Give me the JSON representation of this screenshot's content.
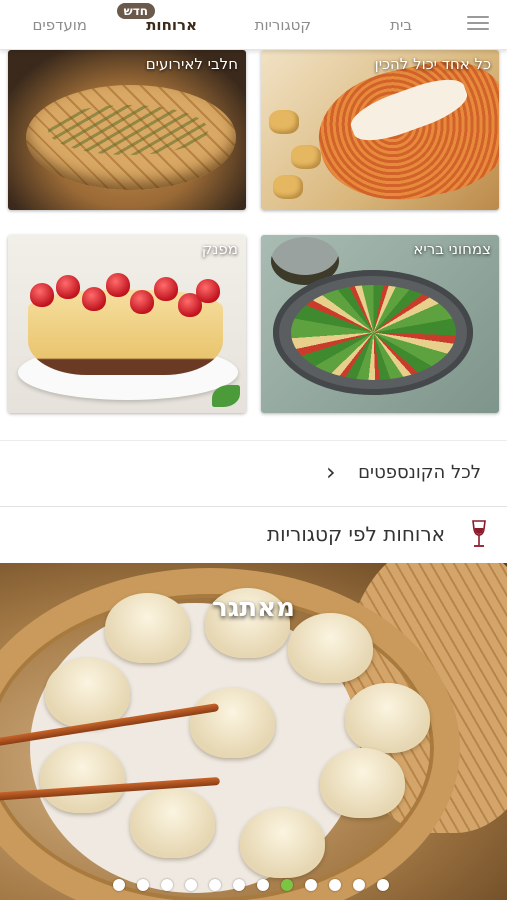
{
  "nav": {
    "home": "בית",
    "categories": "קטגוריות",
    "meals": "ארוחות",
    "clubs": "מועדפים",
    "new_badge": "חדש"
  },
  "cards": [
    {
      "label": "חלבי לאירועים"
    },
    {
      "label": "כל אחד יכול להכין"
    },
    {
      "label": "מפנק"
    },
    {
      "label": "צמחוני בריא"
    }
  ],
  "all_concepts_label": "לכל הקונספטים",
  "meals_by_category_label": "ארוחות לפי קטגוריות",
  "banner": {
    "title": "מאתגר",
    "slide_count": 12,
    "active_slide": 8
  },
  "colors": {
    "accent_green": "#7cc443",
    "badge_brown": "#6b5a4b",
    "wine": "#8b1a2b"
  }
}
